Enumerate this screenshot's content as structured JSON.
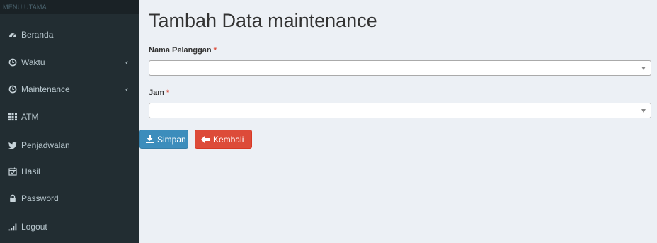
{
  "sidebar": {
    "header": "MENU UTAMA",
    "items": [
      {
        "label": "Beranda",
        "icon": "dashboard-icon",
        "has_submenu": false
      },
      {
        "label": "Waktu",
        "icon": "clock-icon",
        "has_submenu": true
      },
      {
        "label": "Maintenance",
        "icon": "clock-icon",
        "has_submenu": true
      },
      {
        "label": "ATM",
        "icon": "grid-icon",
        "has_submenu": false
      },
      {
        "label": "Penjadwalan",
        "icon": "twitter-icon",
        "has_submenu": false
      },
      {
        "label": "Hasil",
        "icon": "calendar-check-icon",
        "has_submenu": false
      },
      {
        "label": "Password",
        "icon": "lock-icon",
        "has_submenu": false
      },
      {
        "label": "Logout",
        "icon": "signal-icon",
        "has_submenu": false
      }
    ],
    "chevron": "‹"
  },
  "page": {
    "title": "Tambah Data maintenance"
  },
  "form": {
    "customer_label": "Nama Pelanggan",
    "customer_value": "",
    "time_label": "Jam",
    "time_value": "",
    "required_mark": "*"
  },
  "buttons": {
    "save_label": "Simpan",
    "back_label": "Kembali"
  },
  "colors": {
    "sidebar_bg": "#222d32",
    "content_bg": "#ecf0f5",
    "primary": "#3c8dbc",
    "danger": "#dd4b39"
  }
}
